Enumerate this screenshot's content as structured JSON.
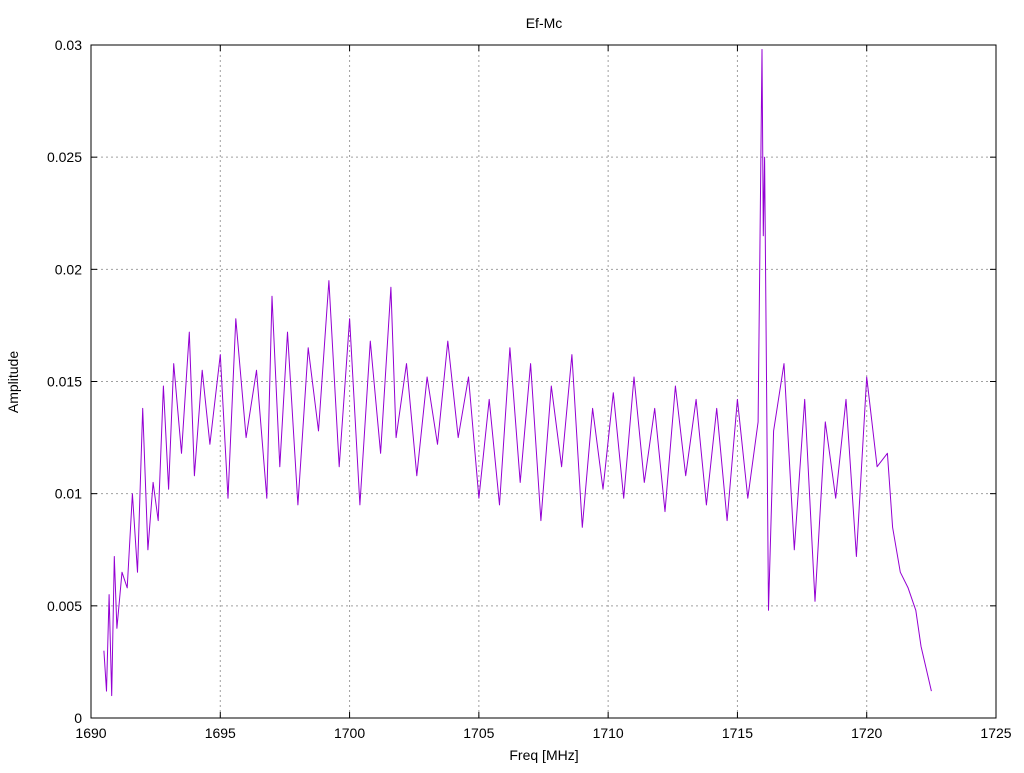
{
  "chart_data": {
    "type": "line",
    "title": "Ef-Mc",
    "xlabel": "Freq [MHz]",
    "ylabel": "Amplitude",
    "xlim": [
      1690,
      1725
    ],
    "ylim": [
      0,
      0.03
    ],
    "xticks": [
      1690,
      1695,
      1700,
      1705,
      1710,
      1715,
      1720,
      1725
    ],
    "yticks": [
      0,
      0.005,
      0.01,
      0.015,
      0.02,
      0.025,
      0.03
    ],
    "xtick_labels": [
      "1690",
      "1695",
      "1700",
      "1705",
      "1710",
      "1715",
      "1720",
      "1725"
    ],
    "ytick_labels": [
      "0",
      "0.005",
      "0.01",
      "0.015",
      "0.02",
      "0.025",
      "0.03"
    ],
    "grid": true,
    "legend": "none",
    "series_color": "#9400d3",
    "series": [
      {
        "x": [
          1690.5,
          1690.6,
          1690.7,
          1690.8,
          1690.9,
          1691.0,
          1691.2,
          1691.4,
          1691.6,
          1691.8,
          1692.0,
          1692.2,
          1692.4,
          1692.6,
          1692.8,
          1693.0,
          1693.2,
          1693.5,
          1693.8,
          1694.0,
          1694.3,
          1694.6,
          1695.0,
          1695.3,
          1695.6,
          1696.0,
          1696.4,
          1696.8,
          1697.0,
          1697.3,
          1697.6,
          1698.0,
          1698.4,
          1698.8,
          1699.2,
          1699.6,
          1700.0,
          1700.4,
          1700.8,
          1701.2,
          1701.6,
          1701.8,
          1702.2,
          1702.6,
          1703.0,
          1703.4,
          1703.8,
          1704.2,
          1704.6,
          1705.0,
          1705.4,
          1705.8,
          1706.2,
          1706.6,
          1707.0,
          1707.4,
          1707.8,
          1708.2,
          1708.6,
          1709.0,
          1709.4,
          1709.8,
          1710.2,
          1710.6,
          1711.0,
          1711.4,
          1711.8,
          1712.2,
          1712.6,
          1713.0,
          1713.4,
          1713.8,
          1714.2,
          1714.6,
          1715.0,
          1715.4,
          1715.8,
          1715.95,
          1716.0,
          1716.05,
          1716.2,
          1716.4,
          1716.8,
          1717.2,
          1717.6,
          1718.0,
          1718.4,
          1718.8,
          1719.2,
          1719.6,
          1720.0,
          1720.4,
          1720.8,
          1721.0,
          1721.3,
          1721.6,
          1721.9,
          1722.1,
          1722.3,
          1722.5
        ],
        "y": [
          0.003,
          0.0012,
          0.0055,
          0.001,
          0.0072,
          0.004,
          0.0065,
          0.0058,
          0.01,
          0.0065,
          0.0138,
          0.0075,
          0.0105,
          0.0088,
          0.0148,
          0.0102,
          0.0158,
          0.0118,
          0.0172,
          0.0108,
          0.0155,
          0.0122,
          0.0162,
          0.0098,
          0.0178,
          0.0125,
          0.0155,
          0.0098,
          0.0188,
          0.0112,
          0.0172,
          0.0095,
          0.0165,
          0.0128,
          0.0195,
          0.0112,
          0.0178,
          0.0095,
          0.0168,
          0.0118,
          0.0192,
          0.0125,
          0.0158,
          0.0108,
          0.0152,
          0.0122,
          0.0168,
          0.0125,
          0.0152,
          0.0098,
          0.0142,
          0.0095,
          0.0165,
          0.0105,
          0.0158,
          0.0088,
          0.0148,
          0.0112,
          0.0162,
          0.0085,
          0.0138,
          0.0102,
          0.0145,
          0.0098,
          0.0152,
          0.0105,
          0.0138,
          0.0092,
          0.0148,
          0.0108,
          0.0142,
          0.0095,
          0.0138,
          0.0088,
          0.0142,
          0.0098,
          0.0132,
          0.0298,
          0.0215,
          0.025,
          0.0048,
          0.0128,
          0.0158,
          0.0075,
          0.0142,
          0.0052,
          0.0132,
          0.0098,
          0.0142,
          0.0072,
          0.0152,
          0.0112,
          0.0118,
          0.0085,
          0.0065,
          0.0058,
          0.0048,
          0.0032,
          0.0022,
          0.0012
        ]
      }
    ]
  }
}
